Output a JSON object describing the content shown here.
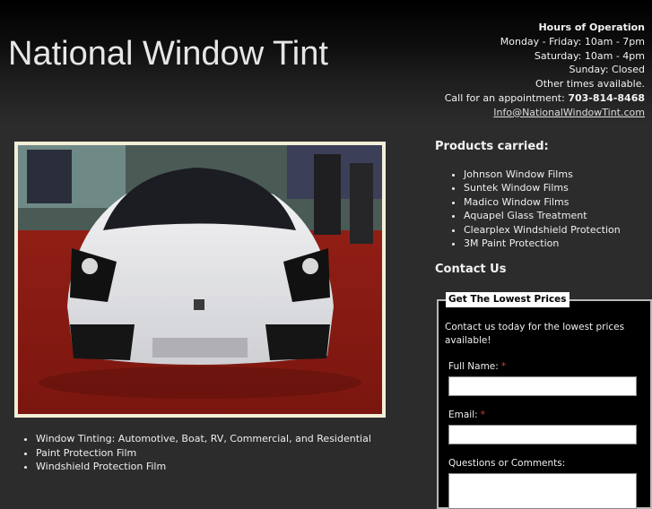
{
  "header": {
    "site_title": "National Window Tint",
    "hours": {
      "title": "Hours of Operation",
      "weekday": "Monday - Friday: 10am - 7pm",
      "saturday": "Saturday: 10am - 4pm",
      "sunday": "Sunday: Closed",
      "other": "Other times available.",
      "call_prefix": "Call for an appointment: ",
      "phone": "703-814-8468",
      "email": "Info@NationalWindowTint.com"
    }
  },
  "services": [
    "Window Tinting: Automotive, Boat, RV, Commercial, and Residential",
    "Paint Protection Film",
    "Windshield Protection Film"
  ],
  "products": {
    "heading": "Products carried:",
    "items": [
      "Johnson Window Films",
      "Suntek Window Films",
      "Madico Window Films",
      "Aquapel Glass Treatment",
      "Clearplex Windshield Protection",
      "3M Paint Protection"
    ]
  },
  "contact": {
    "heading": "Contact Us",
    "form": {
      "legend": "Get The Lowest Prices",
      "intro": "Contact us today for the lowest prices available!",
      "full_name_label": "Full Name:",
      "email_label": "Email:",
      "questions_label": "Questions or Comments:",
      "required_mark": "*"
    }
  }
}
